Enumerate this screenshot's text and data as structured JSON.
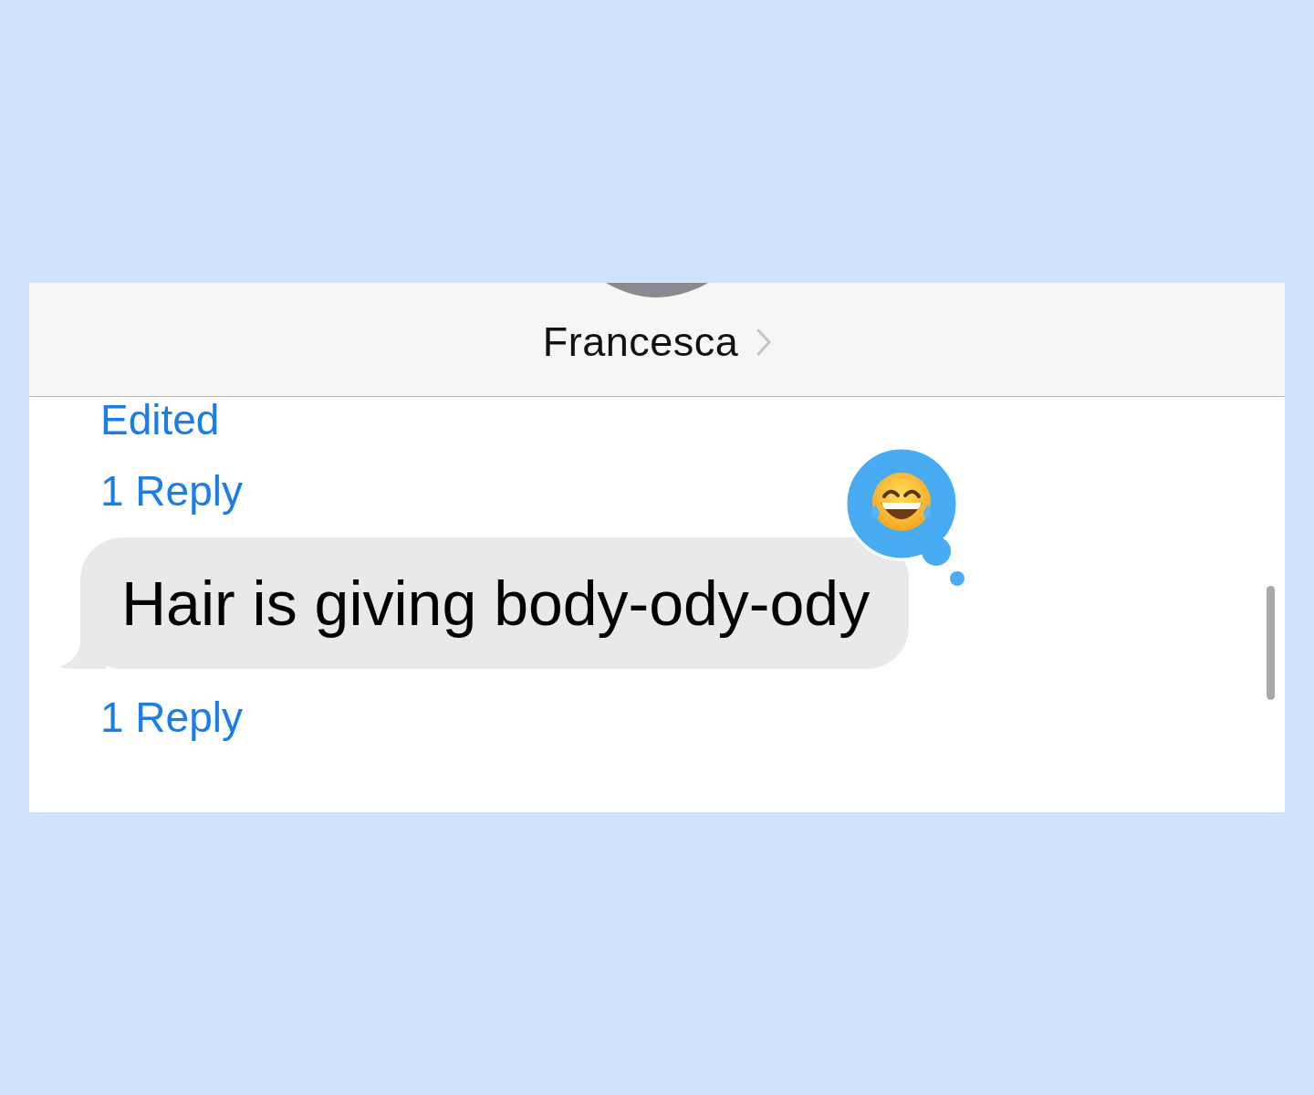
{
  "header": {
    "contact_name": "Francesca"
  },
  "thread": [
    {
      "kind": "edited",
      "text": "Edited"
    },
    {
      "kind": "replies",
      "text": "1 Reply"
    },
    {
      "kind": "bubble",
      "text": "Hair is giving body-ody-ody",
      "reaction": {
        "kind": "laugh"
      }
    },
    {
      "kind": "replies",
      "text": "1 Reply"
    }
  ]
}
